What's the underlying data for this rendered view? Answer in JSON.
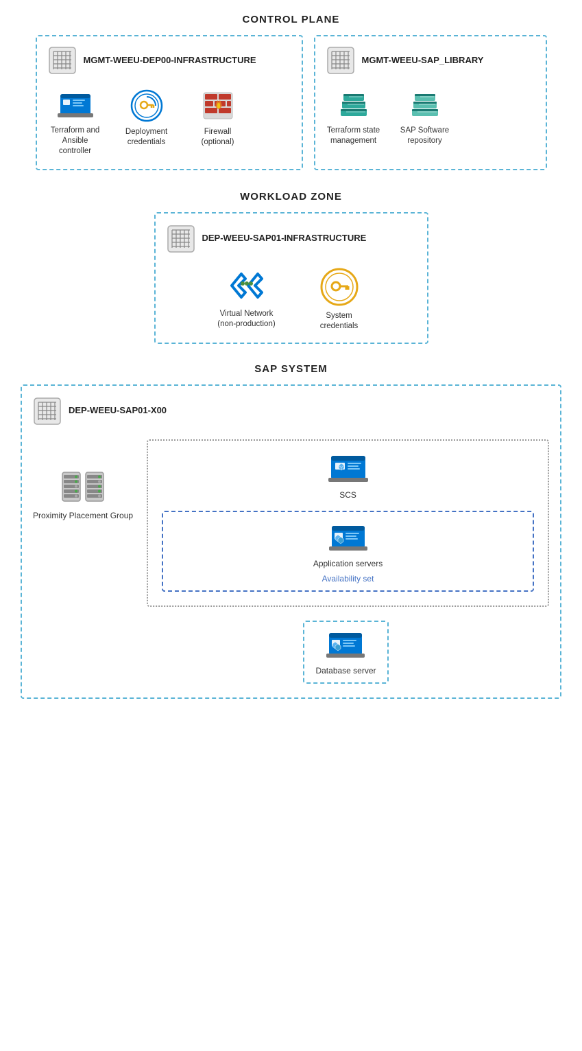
{
  "controlPlane": {
    "title": "CONTROL PLANE",
    "leftBox": {
      "name": "MGMT-WEEU-DEP00-INFRASTRUCTURE",
      "items": [
        {
          "id": "terraform",
          "label": "Terraform and Ansible controller"
        },
        {
          "id": "deployment",
          "label": "Deployment credentials"
        },
        {
          "id": "firewall",
          "label": "Firewall (optional)"
        }
      ]
    },
    "rightBox": {
      "name": "MGMT-WEEU-SAP_LIBRARY",
      "items": [
        {
          "id": "tfstate",
          "label": "Terraform state management"
        },
        {
          "id": "sapsoftware",
          "label": "SAP Software repository"
        }
      ]
    }
  },
  "workloadZone": {
    "title": "WORKLOAD ZONE",
    "box": {
      "name": "DEP-WEEU-SAP01-INFRASTRUCTURE",
      "items": [
        {
          "id": "vnet",
          "label": "Virtual Network (non-production)"
        },
        {
          "id": "syscred",
          "label": "System credentials"
        }
      ]
    }
  },
  "sapSystem": {
    "title": "SAP SYSTEM",
    "box": {
      "name": "DEP-WEEU-SAP01-X00",
      "ppg": {
        "label": "Proximity Placement Group"
      },
      "inner": {
        "scs": {
          "label": "SCS"
        },
        "availSet": {
          "appServers": {
            "label": "Application servers"
          },
          "label": "Availability set"
        }
      },
      "db": {
        "label": "Database server"
      }
    }
  }
}
